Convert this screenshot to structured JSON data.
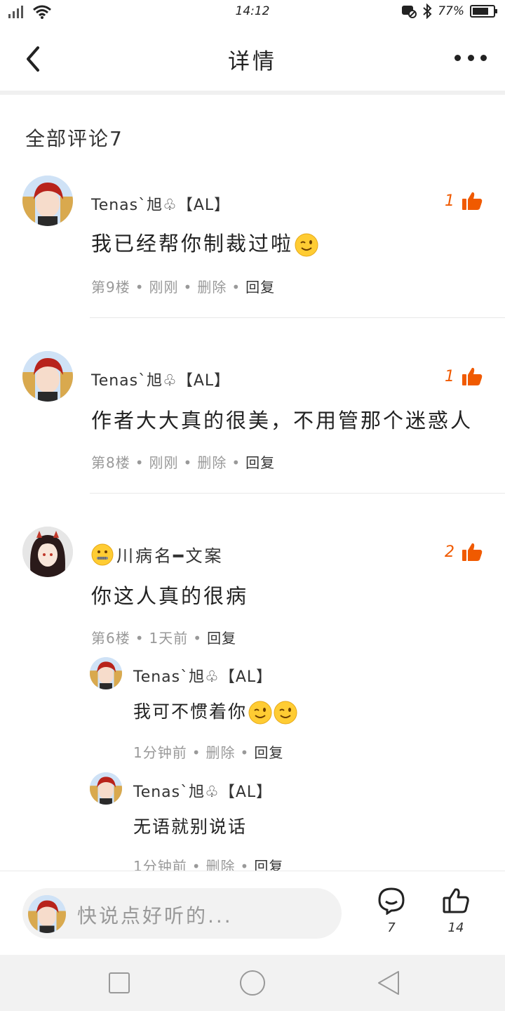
{
  "status": {
    "time": "14:12",
    "battery": "77%",
    "battery_level": 0.77
  },
  "header": {
    "title": "详情"
  },
  "section": {
    "title": "全部评论7"
  },
  "comments": [
    {
      "author": "Tenas`旭♧【AL】",
      "text": "我已经帮你制裁过啦",
      "floor": "第9楼",
      "time": "刚刚",
      "delete": "删除",
      "reply": "回复",
      "likes": "1"
    },
    {
      "author": "Tenas`旭♧【AL】",
      "text": "作者大大真的很美，不用管那个迷惑人",
      "floor": "第8楼",
      "time": "刚刚",
      "delete": "删除",
      "reply": "回复",
      "likes": "1"
    },
    {
      "author": "川病名━文案",
      "text": "你这人真的很病",
      "floor": "第6楼",
      "time": "1天前",
      "reply": "回复",
      "likes": "2",
      "replies": [
        {
          "author": "Tenas`旭♧【AL】",
          "text": "我可不惯着你",
          "time": "1分钟前",
          "delete": "删除",
          "reply": "回复"
        },
        {
          "author": "Tenas`旭♧【AL】",
          "text": "无语就别说话",
          "time": "1分钟前",
          "delete": "删除",
          "reply": "回复"
        }
      ]
    }
  ],
  "input": {
    "placeholder": "快说点好听的..."
  },
  "actions": {
    "comments_count": "7",
    "likes_count": "14"
  },
  "colors": {
    "accent": "#f05a00",
    "muted": "#999999"
  }
}
